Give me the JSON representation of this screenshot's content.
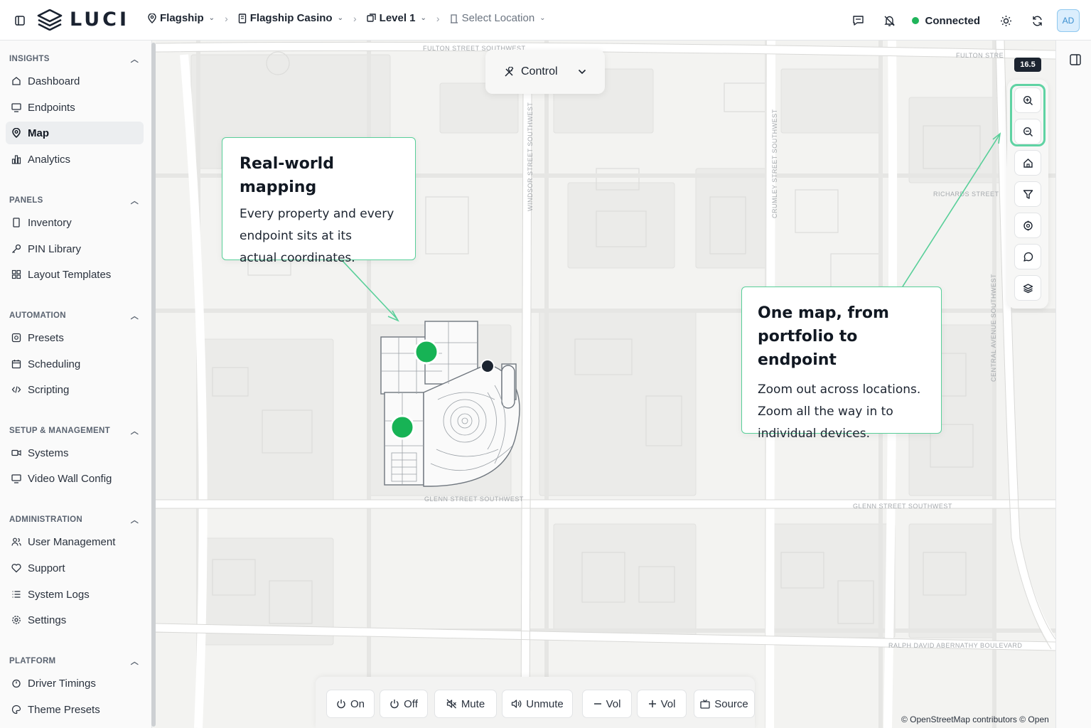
{
  "header": {
    "logo_text": "LUCI",
    "breadcrumbs": [
      {
        "label": "Flagship",
        "icon": "pin-icon"
      },
      {
        "label": "Flagship Casino",
        "icon": "building-icon"
      },
      {
        "label": "Level 1",
        "icon": "layers-icon"
      },
      {
        "label": "Select Location",
        "icon": "door-icon"
      }
    ],
    "status": "Connected",
    "avatar": "AD"
  },
  "sidebar": {
    "sections": [
      {
        "title": "INSIGHTS",
        "items": [
          {
            "label": "Dashboard",
            "icon": "home-icon"
          },
          {
            "label": "Endpoints",
            "icon": "monitor-icon"
          },
          {
            "label": "Map",
            "icon": "map-pin-icon",
            "active": true
          },
          {
            "label": "Analytics",
            "icon": "bar-chart-icon"
          }
        ]
      },
      {
        "title": "PANELS",
        "items": [
          {
            "label": "Inventory",
            "icon": "tablet-icon"
          },
          {
            "label": "PIN Library",
            "icon": "key-icon"
          },
          {
            "label": "Layout Templates",
            "icon": "grid-icon"
          }
        ]
      },
      {
        "title": "AUTOMATION",
        "items": [
          {
            "label": "Presets",
            "icon": "preset-icon"
          },
          {
            "label": "Scheduling",
            "icon": "calendar-icon"
          },
          {
            "label": "Scripting",
            "icon": "code-icon"
          }
        ]
      },
      {
        "title": "SETUP & MANAGEMENT",
        "items": [
          {
            "label": "Systems",
            "icon": "camera-icon"
          },
          {
            "label": "Video Wall Config",
            "icon": "monitor-icon"
          }
        ]
      },
      {
        "title": "ADMINISTRATION",
        "items": [
          {
            "label": "User Management",
            "icon": "users-icon"
          },
          {
            "label": "Support",
            "icon": "support-icon"
          },
          {
            "label": "System Logs",
            "icon": "list-icon"
          },
          {
            "label": "Settings",
            "icon": "gear-icon"
          }
        ]
      },
      {
        "title": "PLATFORM",
        "items": [
          {
            "label": "Driver Timings",
            "icon": "timer-icon"
          },
          {
            "label": "Theme Presets",
            "icon": "palette-icon"
          }
        ]
      }
    ]
  },
  "map": {
    "mode_label": "Control",
    "zoom_level": "16.5",
    "street_labels": [
      "FULTON STREET SOUTHWEST",
      "FULTON STRE",
      "GLENN STREET SOUTHWEST",
      "GLENN STREET SOUTHWEST",
      "RALPH DAVID ABERNATHY BOULEVARD",
      "RICHARDS STREET",
      "WINDSOR STREET SOUTHWEST",
      "CRUMLEY STREET SOUTHWEST",
      "CENTRAL AVENUE SOUTHWEST"
    ],
    "callouts": [
      {
        "title": "Real-world mapping",
        "body": [
          "Every property and every",
          "endpoint  sits at its",
          "actual coordinates."
        ]
      },
      {
        "title": [
          "One map, from",
          "portfolio to endpoint"
        ],
        "body": [
          "Zoom out across locations.",
          "Zoom all the way in to",
          "individual devices."
        ]
      }
    ],
    "attribution": "© OpenStreetMap contributors © Open"
  },
  "map_controls": [
    "zoom-in-icon",
    "zoom-out-icon",
    "home-icon",
    "filter-icon",
    "target-icon",
    "chat-icon",
    "layers-icon"
  ],
  "bottom_bar": [
    {
      "label": "On",
      "icon": "power-icon"
    },
    {
      "label": "Off",
      "icon": "power-icon"
    },
    {
      "label": "Mute",
      "icon": "mute-icon"
    },
    {
      "label": "Unmute",
      "icon": "speaker-icon"
    },
    {
      "label": "Vol",
      "icon": "minus-icon"
    },
    {
      "label": "Vol",
      "icon": "plus-icon"
    },
    {
      "label": "Source",
      "icon": "source-icon"
    }
  ],
  "colors": {
    "accent": "#58cf99",
    "endpoint_green": "#17b355",
    "endpoint_dark": "#1c2430",
    "status_green": "#1fb45a"
  }
}
